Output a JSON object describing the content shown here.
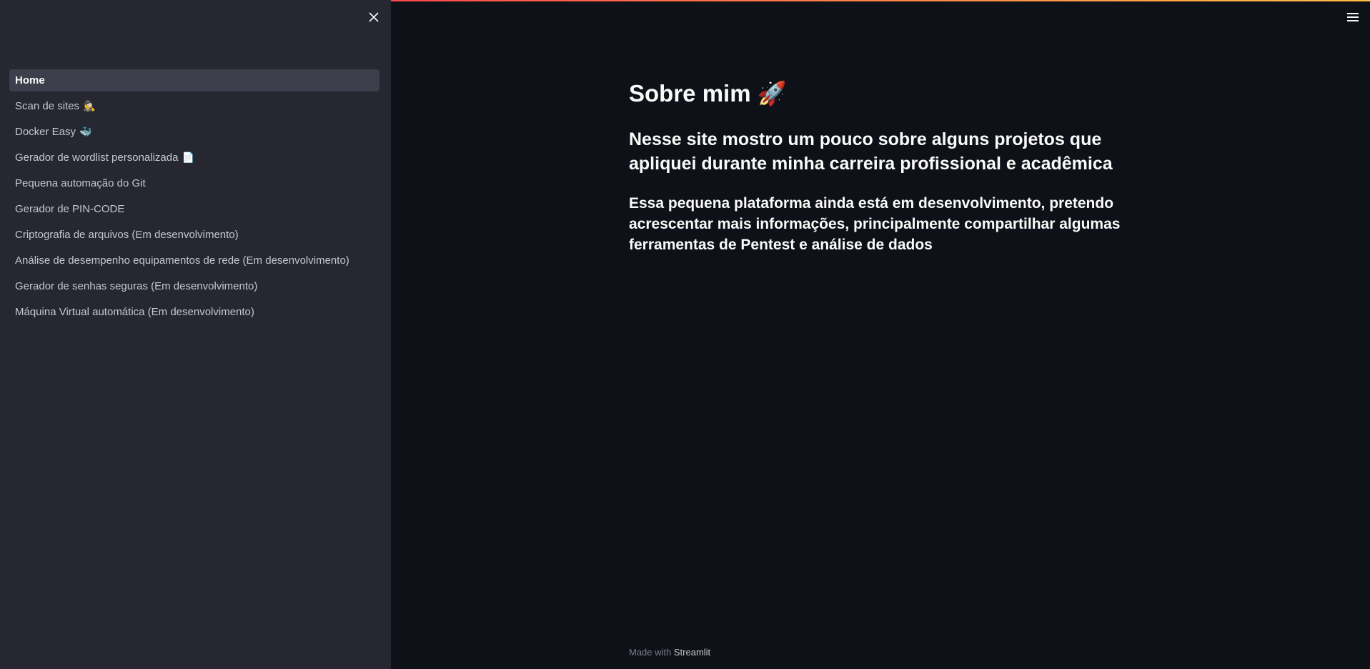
{
  "sidebar": {
    "close_icon": "close-icon",
    "items": [
      {
        "label": "Home",
        "emoji": ""
      },
      {
        "label": "Scan de sites",
        "emoji": "🕵️"
      },
      {
        "label": "Docker Easy",
        "emoji": "🐳"
      },
      {
        "label": "Gerador de wordlist personalizada",
        "emoji": "📄"
      },
      {
        "label": "Pequena automação do Git",
        "emoji": ""
      },
      {
        "label": "Gerador de PIN-CODE",
        "emoji": ""
      },
      {
        "label": "Criptografia de arquivos (Em desenvolvimento)",
        "emoji": ""
      },
      {
        "label": "Análise de desempenho equipamentos de rede (Em desenvolvimento)",
        "emoji": ""
      },
      {
        "label": "Gerador de senhas seguras (Em desenvolvimento)",
        "emoji": ""
      },
      {
        "label": "Máquina Virtual automática (Em desenvolvimento)",
        "emoji": ""
      }
    ]
  },
  "header": {
    "menu_icon": "hamburger-menu-icon"
  },
  "main": {
    "title": "Sobre mim 🚀",
    "subtitle": "Nesse site mostro um pouco sobre alguns projetos que apliquei durante minha carreira profissional e acadêmica",
    "description": "Essa pequena plataforma ainda está em desenvolvimento, pretendo acrescentar mais informações, principalmente compartilhar algumas ferramentas de Pentest e análise de dados"
  },
  "footer": {
    "made_with": "Made with",
    "brand": "Streamlit"
  },
  "colors": {
    "sidebar_bg": "#262730",
    "main_bg": "#0e1117",
    "active_item_bg": "#3d3f4c",
    "text": "#fafafa"
  }
}
